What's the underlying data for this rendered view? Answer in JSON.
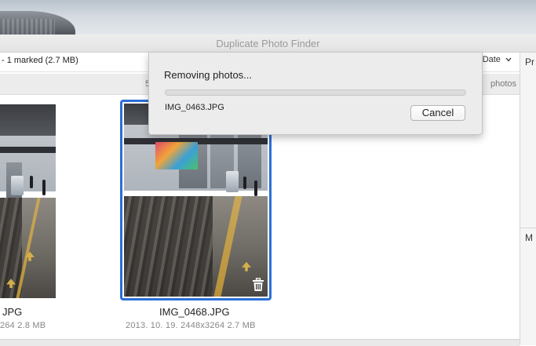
{
  "window": {
    "title": "Duplicate Photo Finder"
  },
  "toolbar": {
    "marked_text": "- 1 marked (2.7 MB)",
    "sort_label": "Date",
    "sort_chevron": "chevron-down-icon"
  },
  "group_header": {
    "count_left": "5",
    "count_right": "photos"
  },
  "inspector": {
    "label_top": "Pr",
    "label_bottom": "M"
  },
  "photos": [
    {
      "name": "JPG",
      "meta": "264  2.8 MB",
      "marked": false
    },
    {
      "name": "IMG_0468.JPG",
      "meta": "2013. 10. 19.  2448x3264  2.7 MB",
      "marked": true,
      "badge_icon": "trash-icon"
    }
  ],
  "dialog": {
    "message": "Removing photos...",
    "current_file": "IMG_0463.JPG",
    "cancel_label": "Cancel",
    "progress": 0.0
  },
  "colors": {
    "selection": "#2b6fd6",
    "progress_fill": "#5a9ae8"
  }
}
